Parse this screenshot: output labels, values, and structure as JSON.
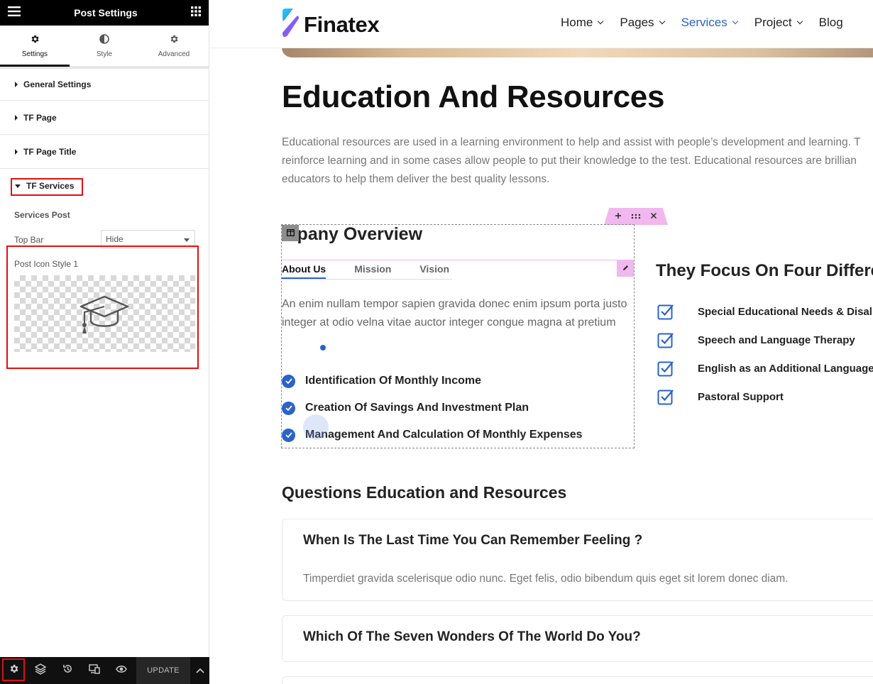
{
  "panel": {
    "title": "Post Settings",
    "tabs": [
      {
        "label": "Settings",
        "icon": "gear-icon"
      },
      {
        "label": "Style",
        "icon": "half-circle-icon"
      },
      {
        "label": "Advanced",
        "icon": "gear-icon"
      }
    ],
    "sections": [
      {
        "label": "General Settings"
      },
      {
        "label": "TF Page"
      },
      {
        "label": "TF Page Title"
      },
      {
        "label": "TF Services"
      }
    ],
    "services_heading": "Services Post",
    "top_bar_label": "Top Bar",
    "top_bar_value": "Hide",
    "post_icon_label": "Post Icon Style 1",
    "update_label": "UPDATE",
    "highlight_color": "#e01010"
  },
  "site": {
    "brand": "Finatex",
    "nav": [
      {
        "label": "Home"
      },
      {
        "label": "Pages"
      },
      {
        "label": "Services",
        "active": true
      },
      {
        "label": "Project"
      },
      {
        "label": "Blog"
      }
    ],
    "accent": "#2a63c9",
    "page_title": "Education And Resources",
    "intro": [
      "Educational resources are used in a learning environment to help and assist with people’s development and learning. T",
      "reinforce learning and in some cases allow people to put their knowledge to the test. Educational resources are brillian",
      "educators to help them deliver the best quality lessons."
    ],
    "overview_title": "Company Overview",
    "tabs": [
      "About Us",
      "Mission",
      "Vision"
    ],
    "tab_body": "An enim nullam tempor sapien gravida donec enim ipsum porta justo integer at odio velna vitae auctor integer congue magna at pretium",
    "checks": [
      "Identification Of Monthly Income",
      "Creation Of Savings And Investment Plan",
      "Management And Calculation Of Monthly Expenses"
    ],
    "focus_title": "They Focus On Four Differe",
    "focus_items": [
      "Special Educational Needs & Disal",
      "Speech and Language Therapy",
      "English as an Additional Language",
      "Pastoral Support"
    ],
    "questions_title": "Questions Education and Resources",
    "faqs": [
      {
        "q": "When Is The Last Time You Can Remember Feeling ?",
        "a": "Timperdiet gravida scelerisque odio nunc. Eget felis, odio bibendum quis eget sit lorem donec diam."
      },
      {
        "q": "Which Of The Seven Wonders Of The World Do You?"
      }
    ]
  }
}
